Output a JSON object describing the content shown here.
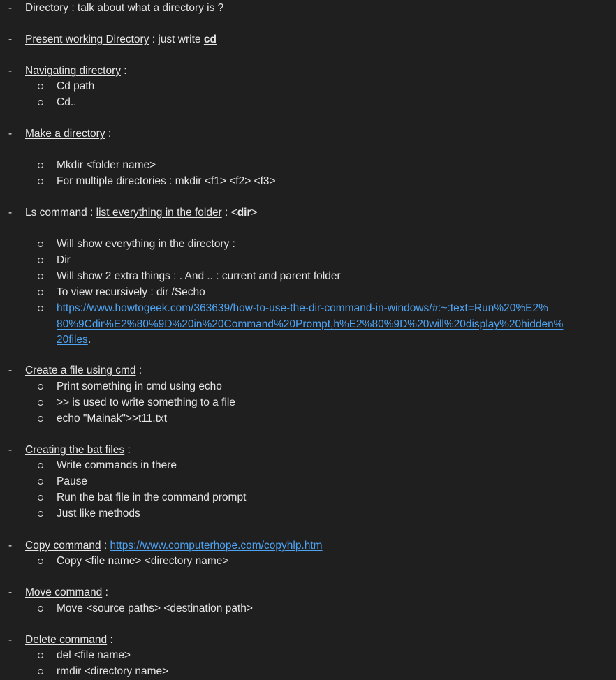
{
  "bullets": {
    "dash": "-"
  },
  "sections": {
    "directory": {
      "title": "Directory",
      "rest": " : talk about what a directory is ?"
    },
    "pwd": {
      "title": "Present working Directory",
      "rest": " : just write ",
      "cmd": "cd"
    },
    "navigate": {
      "title": "Navigating directory",
      "rest": " :",
      "items": [
        "Cd path",
        "Cd.."
      ]
    },
    "mkdir": {
      "title": "Make a directory",
      "rest": " :",
      "items": [
        "Mkdir <folder name>",
        "For multiple directories : mkdir <f1> <f2> <f3>"
      ]
    },
    "ls": {
      "pre": "Ls command : ",
      "title": "list everything in the folder",
      "mid": " : <",
      "cmd": "dir",
      "end": ">",
      "items": [
        "Will show everything in the directory :",
        "Dir",
        "Will show 2 extra things : . And .. : current and parent folder",
        "To view recursively : dir /Secho"
      ],
      "link_lines": [
        "https://www.howtogeek.com/363639/how-to-use-the-dir-command-in-windows/#:~:text=Run%20%E2%",
        "80%9Cdir%E2%80%9D%20in%20Command%20Prompt,h%E2%80%9D%20will%20display%20hidden%",
        "20files"
      ],
      "link_end": "."
    },
    "create_file": {
      "title": "Create a file using cmd",
      "rest": " :",
      "items": [
        "Print something in cmd using echo",
        ">> is used to write something to a file",
        "echo \"Mainak\">>t11.txt"
      ]
    },
    "bat": {
      "title": "Creating the bat files",
      "rest": " :",
      "items": [
        "Write commands in there",
        "Pause",
        "Run the bat file in the command prompt",
        "Just like methods"
      ]
    },
    "copy": {
      "title": "Copy command",
      "rest": " : ",
      "link": "https://www.computerhope.com/copyhlp.htm",
      "items": [
        "Copy <file name> <directory name>"
      ]
    },
    "move": {
      "title": "Move command",
      "rest": " :",
      "items": [
        "Move <source paths> <destination path>"
      ]
    },
    "delete": {
      "title": "Delete command",
      "rest": " :",
      "items": [
        "del <file name>",
        "rmdir <directory name>"
      ]
    }
  },
  "colors": {
    "background": "#1f1f1f",
    "text": "#e6e6e6",
    "link": "#4ea3f2"
  }
}
